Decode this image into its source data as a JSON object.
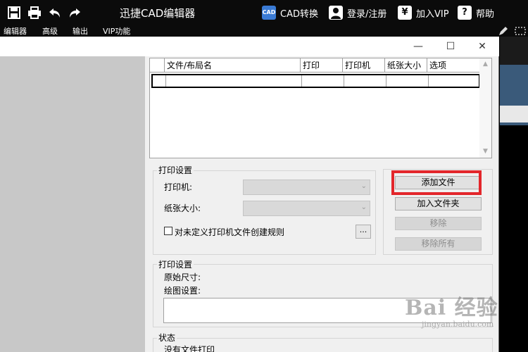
{
  "app": {
    "title": "迅捷CAD编辑器"
  },
  "toolbar_right": {
    "cad_convert": {
      "icon_text": "CAD",
      "label": "CAD转换"
    },
    "login": {
      "label": "登录/注册"
    },
    "vip": {
      "icon_text": "¥",
      "label": "加入VIP"
    },
    "help": {
      "icon_text": "?",
      "label": "帮助"
    }
  },
  "menu": {
    "items": [
      "编辑器",
      "高级",
      "输出",
      "VIP功能"
    ]
  },
  "dialog": {
    "controls": {
      "minimize": "—",
      "maximize": "☐",
      "close": "✕"
    },
    "file_list": {
      "columns": [
        "文件/布局名",
        "打印",
        "打印机",
        "纸张大小",
        "选项"
      ],
      "rows": []
    },
    "print_settings": {
      "title": "打印设置",
      "printer_label": "打印机:",
      "paper_label": "纸张大小:",
      "printer_value": "",
      "paper_value": "",
      "rule_checkbox_label": "对未定义打印机文件创建规则",
      "rule_checkbox_checked": false,
      "ellipsis_label": "..."
    },
    "buttons": {
      "add_file": "添加文件",
      "add_folder": "加入文件夹",
      "remove": "移除",
      "remove_all": "移除所有"
    },
    "plot_settings": {
      "title": "打印设置",
      "original_size_label": "原始尺寸:",
      "drawing_settings_label": "绘图设置:"
    },
    "status": {
      "title": "状态",
      "text": "没有文件打印"
    }
  },
  "watermark": {
    "brand": "Bai 经验",
    "url": "jingyan.baidu.com"
  },
  "colors": {
    "highlight_border": "#e3262b",
    "topbar_bg": "#0b0b0b",
    "dialog_bg": "#f0f0f0"
  }
}
